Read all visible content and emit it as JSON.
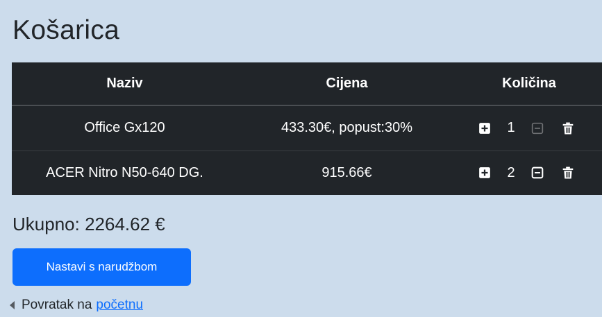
{
  "page": {
    "title": "Košarica"
  },
  "table": {
    "headers": {
      "name": "Naziv",
      "price": "Cijena",
      "quantity": "Količina"
    },
    "rows": [
      {
        "name": "Office Gx120",
        "price": "433.30€, popust:30%",
        "quantity": "1",
        "decrease_enabled": false
      },
      {
        "name": "ACER Nitro N50-640 DG.",
        "price": "915.66€",
        "quantity": "2",
        "decrease_enabled": true
      }
    ],
    "icons": {
      "increase": "plus-square-icon",
      "decrease": "minus-square-icon",
      "remove": "trash-icon"
    }
  },
  "summary": {
    "total_label": "Ukupno: 2264.62 €"
  },
  "actions": {
    "continue_label": "Nastavi s narudžbom"
  },
  "navigation": {
    "back_text": "Povratak na",
    "back_link_text": "početnu"
  },
  "colors": {
    "background": "#ccdcec",
    "table": "#212529",
    "primary": "#0d6efd"
  }
}
